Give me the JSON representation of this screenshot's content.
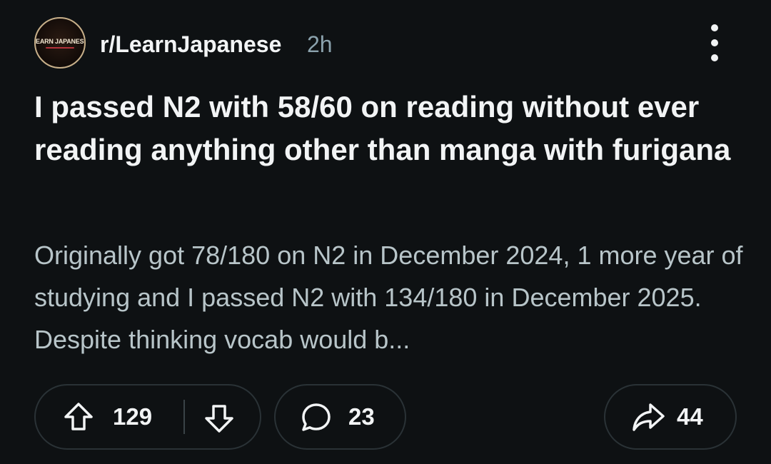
{
  "post": {
    "subreddit": "r/LearnJapanese",
    "time_ago": "2h",
    "avatar_text": "LEARN JAPANESE",
    "title": "I passed N2 with 58/60 on reading without ever reading anything other than manga with furigana",
    "body_preview": "Originally got 78/180 on N2 in December 2024, 1 more year of studying and I passed N2 with 134/180 in December 2025. Despite thinking vocab would b..."
  },
  "actions": {
    "upvotes": "129",
    "comments": "23",
    "shares": "44"
  },
  "icons": {
    "more": "more-vertical-icon",
    "upvote": "arrow-up-icon",
    "downvote": "arrow-down-icon",
    "comment": "speech-bubble-icon",
    "share": "share-arrow-icon"
  },
  "colors": {
    "background": "#0e1113",
    "title": "#f2f4f5",
    "body": "#b8c5c9",
    "meta": "#8ba2ad",
    "pill_border": "#2a3236"
  }
}
